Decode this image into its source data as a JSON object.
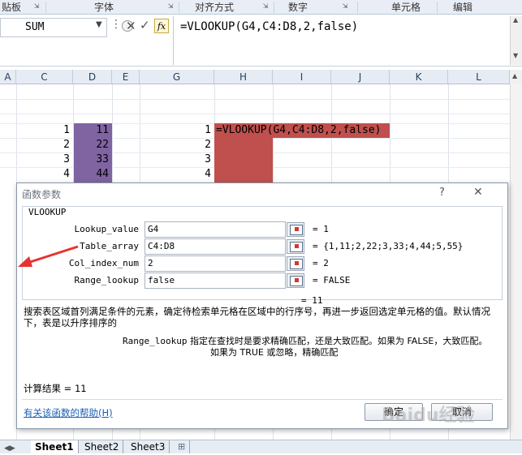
{
  "ribbon": {
    "groups": [
      "贴板",
      "字体",
      "对齐方式",
      "数字",
      "单元格",
      "编辑"
    ]
  },
  "formula_bar": {
    "name_box": "SUM",
    "fx_label": "fx",
    "formula": "=VLOOKUP(G4,C4:D8,2,false)"
  },
  "columns": [
    "A",
    "C",
    "D",
    "E",
    "G",
    "H",
    "I",
    "J",
    "K",
    "L"
  ],
  "sheet": {
    "c_values": [
      "1",
      "2",
      "3",
      "4"
    ],
    "d_values": [
      "11",
      "22",
      "33",
      "44"
    ],
    "g_values": [
      "1",
      "2",
      "3",
      "4"
    ],
    "h1_formula": "=VLOOKUP(G4,C4:D8,2,false)"
  },
  "dialog": {
    "title": "函数参数",
    "help_glyph": "?",
    "close_glyph": "✕",
    "function_name": "VLOOKUP",
    "args": [
      {
        "label": "Lookup_value",
        "input": "G4",
        "result": "= 1"
      },
      {
        "label": "Table_array",
        "input": "C4:D8",
        "result": "= {1,11;2,22;3,33;4,44;5,55}"
      },
      {
        "label": "Col_index_num",
        "input": "2",
        "result": "= 2"
      },
      {
        "label": "Range_lookup",
        "input": "false",
        "result": "= FALSE"
      }
    ],
    "overall_result": "= 11",
    "description": "搜索表区域首列满足条件的元素，确定待检索单元格在区域中的行序号，再进一步返回选定单元格的值。默认情况下，表是以升序排序的",
    "arg_desc_name": "Range_lookup",
    "arg_desc_text": "指定在查找时是要求精确匹配，还是大致匹配。如果为 FALSE，大致匹配。如果为 TRUE 或忽略，精确匹配",
    "calc_result": "计算结果 = 11",
    "help_link": "有关该函数的帮助(H)",
    "ok_label": "确定",
    "cancel_label": "取消"
  },
  "tabs": [
    "Sheet1",
    "Sheet2",
    "Sheet3"
  ],
  "watermark": "Baidu经验",
  "colors": {
    "purple_fill": "#8064a2",
    "red_fill": "#c0504d",
    "arrow": "#e8322e",
    "link": "#1a5fb4"
  }
}
